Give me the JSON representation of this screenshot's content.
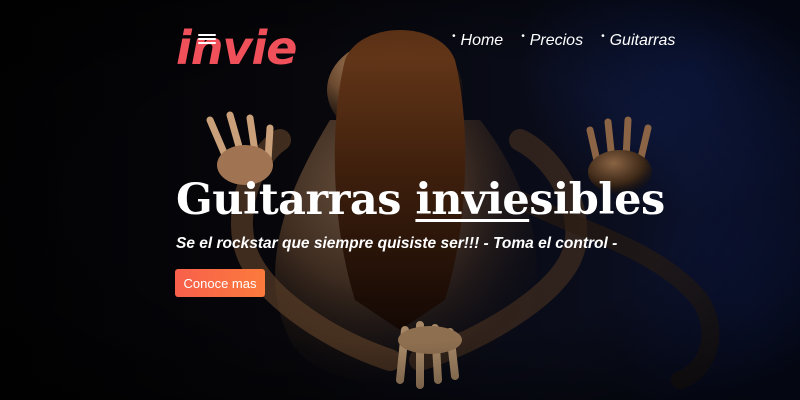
{
  "brand": {
    "logo_text": "invie"
  },
  "nav": {
    "items": [
      {
        "label": "Home"
      },
      {
        "label": "Precios"
      },
      {
        "label": "Guitarras"
      }
    ],
    "bullet": "•"
  },
  "hero": {
    "title_prefix": "Guitarras ",
    "title_highlight": "invie",
    "title_suffix": "sibles",
    "subtitle": "Se el rockstar que siempre quisiste ser!!! - Toma el control -",
    "cta_label": "Conoce mas"
  },
  "colors": {
    "brand": "#f0505a",
    "cta_start": "#f8604c",
    "cta_end": "#fb7a3c",
    "background": "#050507",
    "text": "#ffffff"
  }
}
